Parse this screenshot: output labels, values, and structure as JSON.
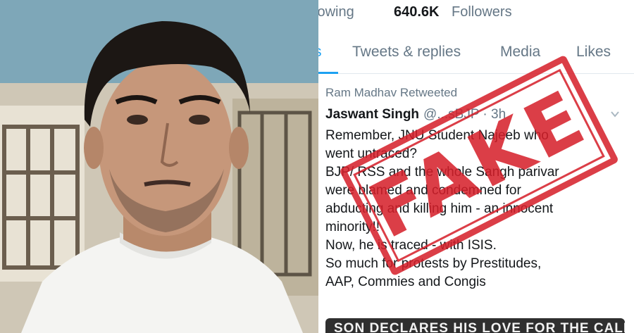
{
  "profile_stats": {
    "following_label": "lowing",
    "followers_count": "640.6K",
    "followers_label": "Followers"
  },
  "tabs": [
    {
      "label": "s"
    },
    {
      "label": "Tweets & replies"
    },
    {
      "label": "Media"
    },
    {
      "label": "Likes"
    }
  ],
  "tweet": {
    "retweeted_by": "Ram Madhav Retweeted",
    "author_name": "Jaswant Singh",
    "author_handle": "@...sBJP · 3h",
    "lines": [
      "Remember, JNU Student Najeeb who",
      "went untraced?",
      "BJP/ RSS and the whole Sangh parivar",
      "were blamed and condemned for",
      "abducting and killing him - an innocent",
      "minority!!",
      "Now, he is traced - with ISIS.",
      "So much for protests by Prestitudes,",
      "AAP, Commies and Congis"
    ],
    "card_headline": "SON DECLARES HIS LOVE FOR THE CALIPHATE"
  },
  "stamp": {
    "text": "FAKE",
    "color": "#d61f2a"
  },
  "colors": {
    "accent": "#1da1f2",
    "text_primary": "#14171a",
    "text_secondary": "#657786"
  }
}
